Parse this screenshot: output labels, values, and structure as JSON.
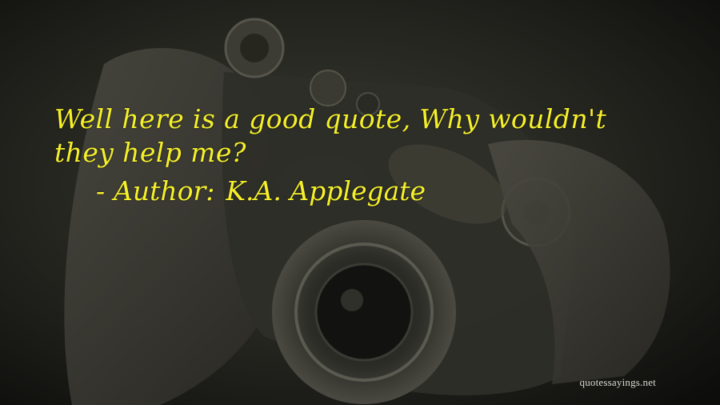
{
  "quote": {
    "text": "Well here is a good quote, Why wouldn't they help me?",
    "author_dash": "-",
    "author_label": "Author:",
    "author_name": "K.A. Applegate"
  },
  "watermark": {
    "text": "quotessayings.net"
  },
  "colors": {
    "quote_text": "#f5f02a",
    "background": "#151512",
    "watermark": "#e8e8e0"
  },
  "image": {
    "subject": "camera-in-hands-photo"
  }
}
